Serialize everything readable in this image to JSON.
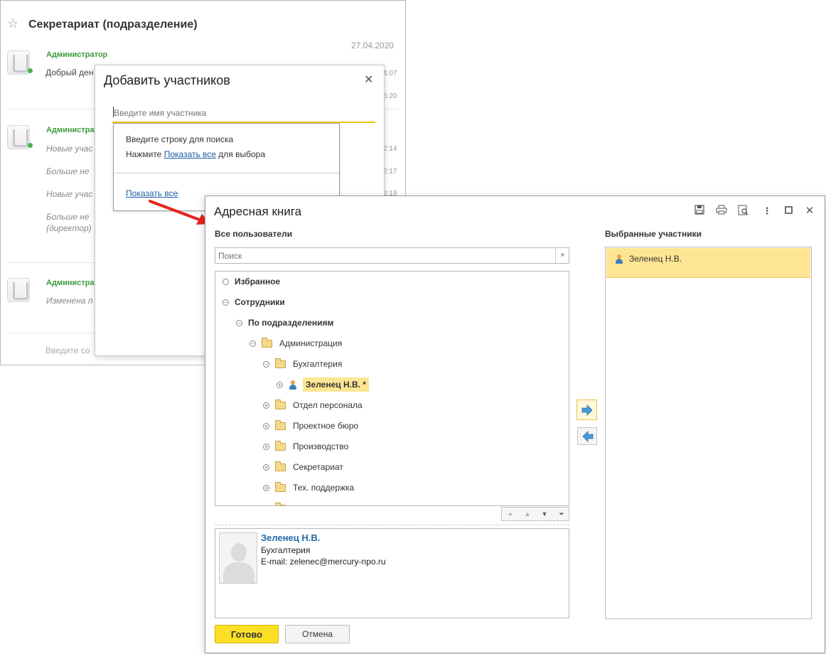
{
  "chat": {
    "title": "Секретариат (подразделение)",
    "date": "27.04.2020",
    "messages": [
      {
        "author": "Администратор",
        "text": "Добрый ден",
        "times": [
          "4:07",
          "5:20"
        ]
      },
      {
        "author": "Администрат",
        "lines": [
          {
            "text": "Новые учас",
            "time": "2:14"
          },
          {
            "text": "Больше не",
            "time": "2:17"
          },
          {
            "text": "Новые учас",
            "time": "2:19"
          },
          {
            "text": "Больше не",
            "time": ""
          },
          {
            "text": "(директор)",
            "time": ""
          }
        ]
      },
      {
        "author": "Администрат",
        "text": "Изменена п"
      }
    ],
    "input_placeholder": "Введите со"
  },
  "add_dialog": {
    "title": "Добавить участников",
    "close_icon": "close-icon",
    "input_placeholder": "Введите имя участника",
    "suggest_line1": "Введите строку для поиска",
    "suggest_line2_prefix": "Нажмите ",
    "suggest_line2_link": "Показать все",
    "suggest_line2_suffix": " для выбора",
    "show_all_link": "Показать все"
  },
  "address_book": {
    "title": "Адресная книга",
    "toolbar_icons": [
      "save-icon",
      "print-icon",
      "preview-icon",
      "more-icon",
      "maximize-icon",
      "close-icon"
    ],
    "all_users_title": "Все пользователи",
    "search_placeholder": "Поиск",
    "search_clear": "×",
    "tree": [
      {
        "label": "Избранное",
        "toggle": "○",
        "bold": true
      },
      {
        "label": "Сотрудники",
        "toggle": "⊖",
        "bold": true
      },
      {
        "label": "По подразделениям",
        "toggle": "⊖",
        "bold": true
      },
      {
        "label": "Администрация",
        "toggle": "⊖",
        "folder": true
      },
      {
        "label": "Бухгалтерия",
        "toggle": "⊖",
        "folder": true
      },
      {
        "label": "Зеленец Н.В. *",
        "toggle": "⊕",
        "user": true,
        "selected": true
      },
      {
        "label": "Отдел персонала",
        "toggle": "⊕",
        "folder": true
      },
      {
        "label": "Проектное бюро",
        "toggle": "⊕",
        "folder": true
      },
      {
        "label": "Производство",
        "toggle": "⊕",
        "folder": true
      },
      {
        "label": "Секретариат",
        "toggle": "⊕",
        "folder": true
      },
      {
        "label": "Тех. поддержка",
        "toggle": "⊕",
        "folder": true
      }
    ],
    "card": {
      "name": "Зеленец Н.В.",
      "department": "Бухгалтерия",
      "email": "E-mail: zelenec@mercury-npo.ru"
    },
    "selected_title": "Выбранные участники",
    "selected_items": [
      "Зеленец Н.В."
    ],
    "done_button": "Готово",
    "cancel_button": "Отмена"
  },
  "colors": {
    "accent_yellow": "#fce026",
    "highlight": "#fde593",
    "link": "#1a5ea8",
    "online": "#44b54a",
    "arrow": "#e8211b"
  }
}
